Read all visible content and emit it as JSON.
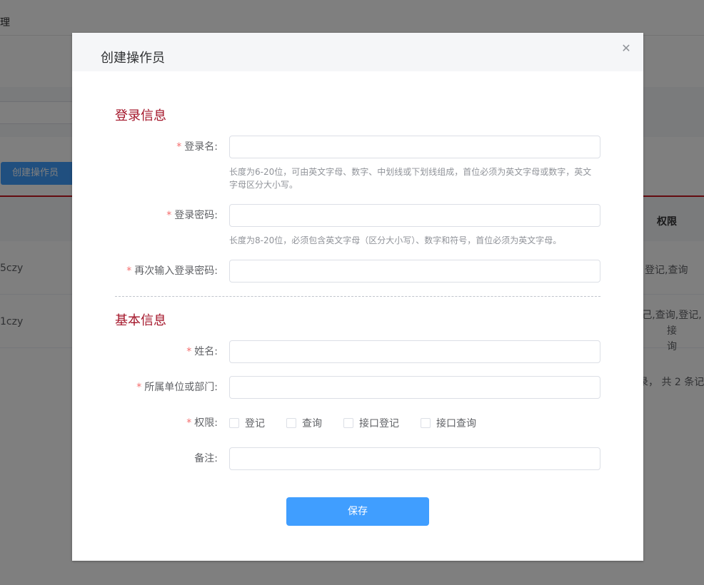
{
  "background": {
    "breadcrumb_tail": "理",
    "create_button": "创建操作员",
    "table_header_permission": "权限",
    "rows": [
      {
        "name": "5czy",
        "permission": "登记,查询"
      },
      {
        "name": "1czy",
        "permission": "己,查询,登记,接\n询"
      }
    ],
    "pager_text": "录， 共 2 条记"
  },
  "dialog": {
    "title": "创建操作员",
    "close_icon": "close-icon",
    "sections": {
      "login": "登录信息",
      "basic": "基本信息"
    },
    "fields": {
      "login_name": {
        "label": "登录名:",
        "value": "",
        "hint": "长度为6-20位，可由英文字母、数字、中划线或下划线组成，首位必须为英文字母或数字，英文字母区分大小写。"
      },
      "password": {
        "label": "登录密码:",
        "value": "",
        "hint": "长度为8-20位，必须包含英文字母（区分大小写）、数字和符号，首位必须为英文字母。"
      },
      "password_confirm": {
        "label": "再次输入登录密码:",
        "value": ""
      },
      "real_name": {
        "label": "姓名:",
        "value": ""
      },
      "department": {
        "label": "所属单位或部门:",
        "value": ""
      },
      "permissions": {
        "label": "权限:",
        "options": [
          {
            "label": "登记",
            "checked": false
          },
          {
            "label": "查询",
            "checked": false
          },
          {
            "label": "接口登记",
            "checked": false
          },
          {
            "label": "接口查询",
            "checked": false
          }
        ]
      },
      "remark": {
        "label": "备注:",
        "value": ""
      }
    },
    "required_mark": "*",
    "save_button": "保存"
  },
  "colors": {
    "accent": "#409eff",
    "section_title": "#a4162a",
    "required": "#f56c6c"
  }
}
